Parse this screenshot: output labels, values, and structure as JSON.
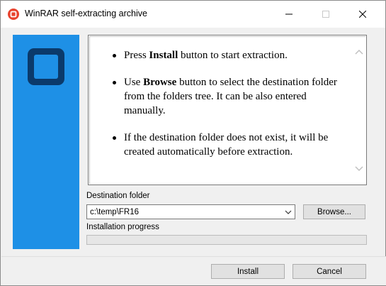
{
  "window": {
    "title": "WinRAR self-extracting archive",
    "icons": {
      "app": "winrar-sfx-icon",
      "minimize": "minimize-icon",
      "maximize": "maximize-icon",
      "close": "close-icon"
    }
  },
  "sidebar": {
    "logo": "winrar-sfx-logo-icon",
    "color": "#1e90e6"
  },
  "info": {
    "items": [
      {
        "before": "Press ",
        "bold": "Install",
        "after": " button to start extraction."
      },
      {
        "before": "Use ",
        "bold": "Browse",
        "after": " button to select the destination folder from the folders tree. It can be also entered manually."
      },
      {
        "before": "",
        "bold": "",
        "after": "If the destination folder does not exist, it will be created automatically before extraction."
      }
    ]
  },
  "destination": {
    "label": "Destination folder",
    "value": "c:\\temp\\FR16",
    "browse_label": "Browse..."
  },
  "progress": {
    "label": "Installation progress",
    "value": 0
  },
  "footer": {
    "install_label": "Install",
    "cancel_label": "Cancel"
  }
}
